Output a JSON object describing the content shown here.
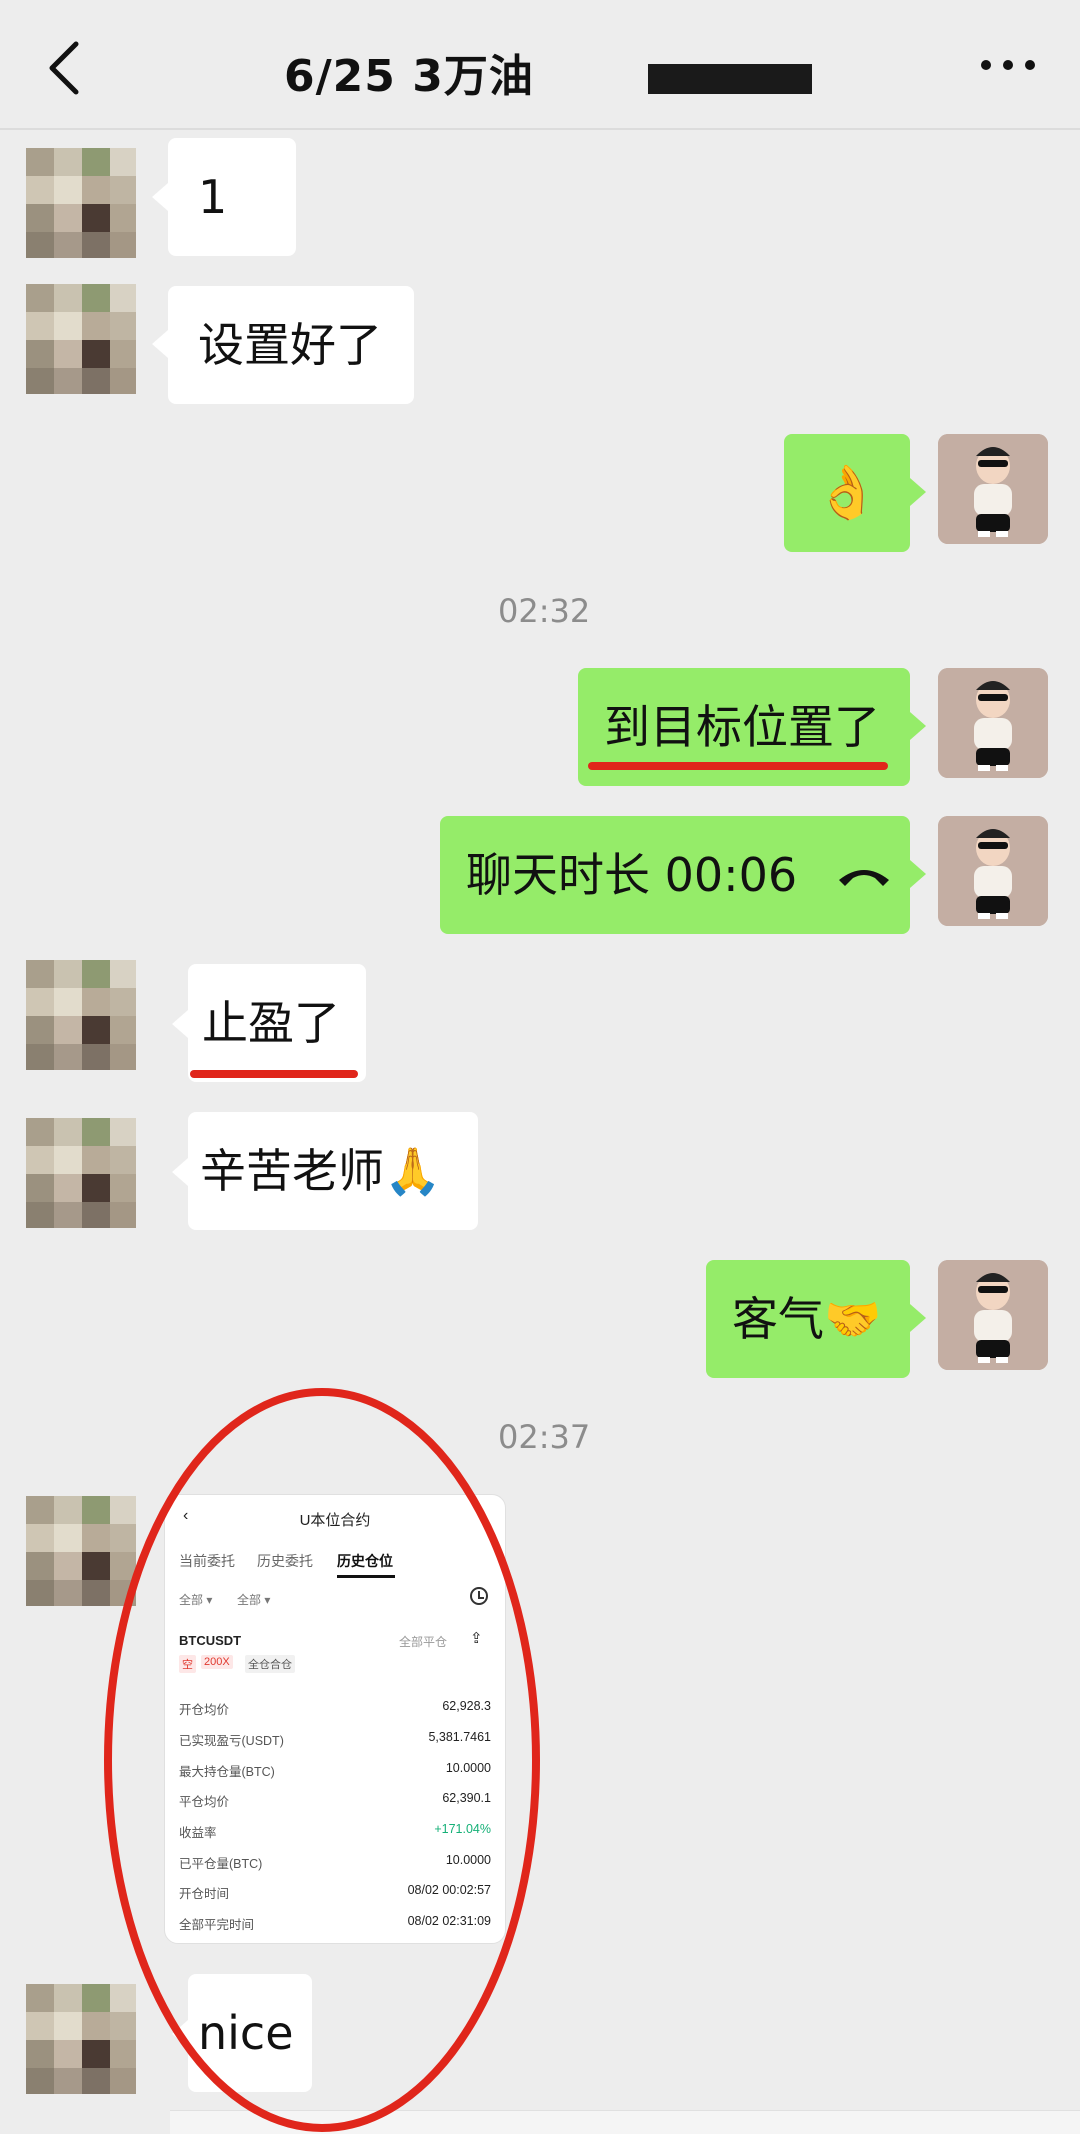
{
  "header": {
    "title": "6/25  3万油",
    "back_icon": "chevron-left-icon",
    "more_icon": "ellipsis-icon"
  },
  "messages": {
    "m1": "1",
    "m2": "设置好了",
    "m3_emoji": "👌",
    "time1": "02:32",
    "m4": "到目标位置了",
    "m5": "聊天时长 00:06",
    "m5_icon": "call-hangup-icon",
    "m6": "止盈了",
    "m7": "辛苦老师🙏",
    "m8": "客气🤝",
    "time2": "02:37",
    "m9": "nice"
  },
  "screenshot": {
    "title": "U本位合约",
    "tabs": [
      "当前委托",
      "历史委托",
      "历史仓位"
    ],
    "active_tab": "历史仓位",
    "filters": [
      "全部 ▾",
      "全部 ▾"
    ],
    "symbol": "BTCUSDT",
    "close_all": "全部平仓",
    "tags": [
      "空",
      "200X",
      "全仓合仓"
    ],
    "rows": [
      {
        "k": "开仓均价",
        "v": "62,928.3"
      },
      {
        "k": "已实现盈亏(USDT)",
        "v": "5,381.7461"
      },
      {
        "k": "最大持仓量(BTC)",
        "v": "10.0000"
      },
      {
        "k": "平仓均价",
        "v": "62,390.1"
      },
      {
        "k": "收益率",
        "v": "+171.04%"
      },
      {
        "k": "已平仓量(BTC)",
        "v": "10.0000"
      },
      {
        "k": "开仓时间",
        "v": "08/02 00:02:57"
      },
      {
        "k": "全部平完时间",
        "v": "08/02 02:31:09"
      }
    ]
  },
  "colors": {
    "green_bubble": "#95ec69",
    "annotation_red": "#e0261b",
    "profit_green": "#15b077"
  }
}
